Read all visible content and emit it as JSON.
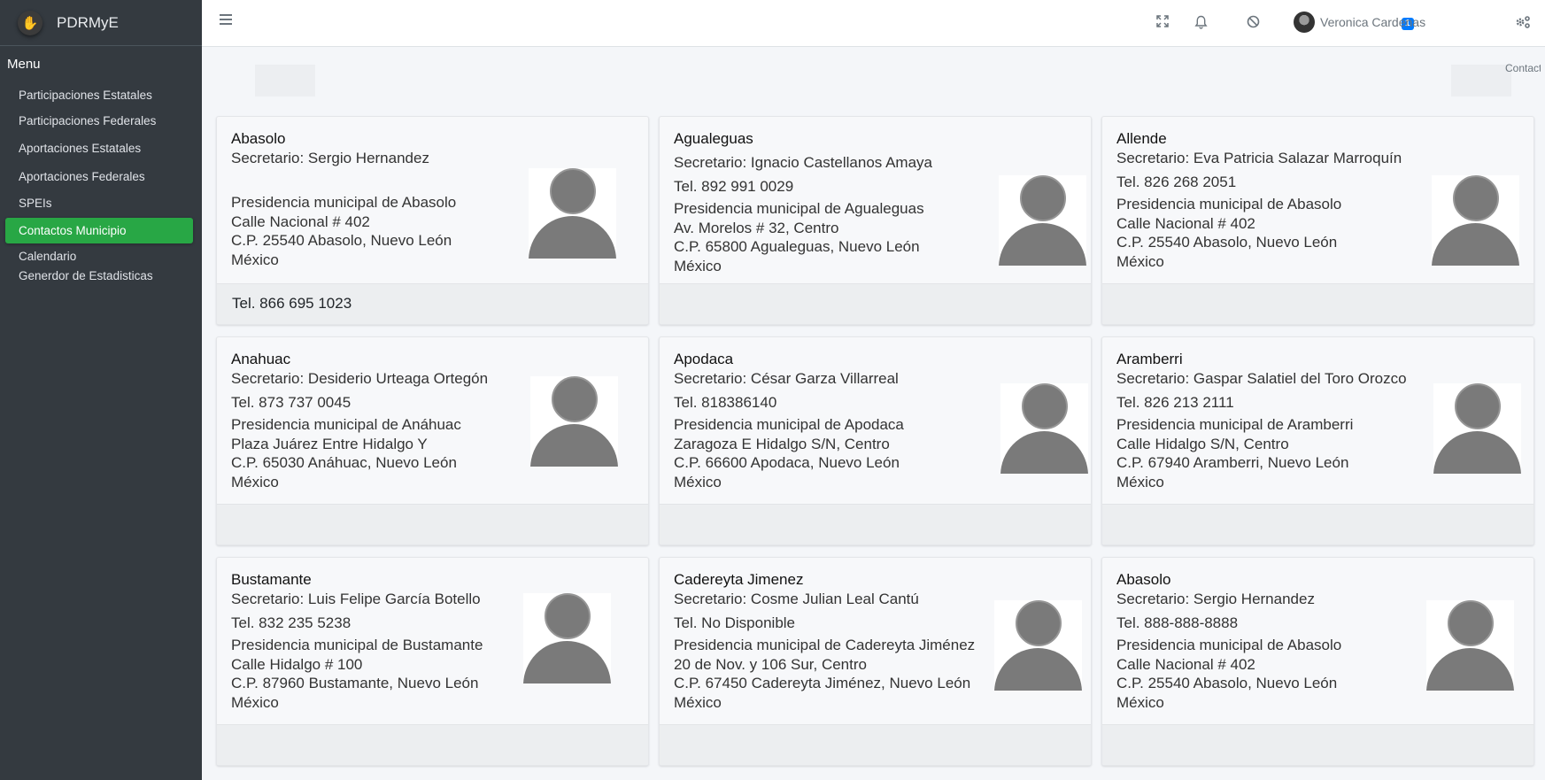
{
  "brand": {
    "name": "PDRMyE"
  },
  "sidebar": {
    "menu_header": "Menu",
    "items": [
      {
        "label": "Participaciones Estatales"
      },
      {
        "label": "Participaciones Federales"
      },
      {
        "label": "Aportaciones Estatales"
      },
      {
        "label": "Aportaciones Federales"
      },
      {
        "label": "SPEIs"
      },
      {
        "label": "Contactos Municipio",
        "active": true
      },
      {
        "label": "Calendario"
      },
      {
        "label": "Generdor de Estadisticas"
      }
    ]
  },
  "topbar": {
    "icons": [
      "menu-icon",
      "fullscreen-icon",
      "bell-icon",
      "ban-icon",
      "gear-icon"
    ],
    "notification_count": "1",
    "user_name": "Veronica Cardenas"
  },
  "breadcrumb": {
    "current": "Contacts"
  },
  "colors": {
    "sidebar": "#343a40",
    "active": "#28a745",
    "badge": "#007bff"
  },
  "cards": [
    {
      "name": "Abasolo",
      "secretary": "Secretario: Sergio Hernandez",
      "tel": "",
      "office": "Presidencia municipal de Abasolo",
      "street": "Calle Nacional # 402",
      "city": "C.P. 25540 Abasolo, Nuevo León",
      "country": "México",
      "footer_tel": "Tel. 866 695 1023"
    },
    {
      "name": "Agualeguas",
      "secretary": "Secretario: Ignacio Castellanos Amaya",
      "tel": "Tel. 892 991 0029",
      "office": "Presidencia municipal de Agualeguas",
      "street": "Av. Morelos # 32, Centro",
      "city": "C.P. 65800 Agualeguas, Nuevo León",
      "country": "México",
      "footer_tel": ""
    },
    {
      "name": "Allende",
      "secretary": "Secretario: Eva Patricia Salazar Marroquín",
      "tel": "Tel. 826 268 2051",
      "office": "Presidencia municipal de Abasolo",
      "street": "Calle Nacional # 402",
      "city": "C.P. 25540 Abasolo, Nuevo León",
      "country": "México",
      "footer_tel": ""
    },
    {
      "name": "Anahuac",
      "secretary": "Secretario: Desiderio Urteaga Ortegón",
      "tel": "Tel. 873 737 0045",
      "office": "Presidencia municipal de Anáhuac",
      "street": "Plaza Juárez Entre Hidalgo Y",
      "city": "C.P. 65030 Anáhuac, Nuevo León",
      "country": "México",
      "footer_tel": ""
    },
    {
      "name": "Apodaca",
      "secretary": "Secretario: César Garza Villarreal",
      "tel": "Tel. 818386140",
      "office": "Presidencia municipal de Apodaca",
      "street": "Zaragoza E Hidalgo S/N, Centro",
      "city": "C.P. 66600 Apodaca, Nuevo León",
      "country": "México",
      "footer_tel": ""
    },
    {
      "name": "Aramberri",
      "secretary": "Secretario: Gaspar Salatiel del Toro Orozco",
      "tel": "Tel. 826 213 2111",
      "office": "Presidencia municipal de Aramberri",
      "street": "Calle Hidalgo S/N, Centro",
      "city": "C.P. 67940 Aramberri, Nuevo León",
      "country": "México",
      "footer_tel": ""
    },
    {
      "name": "Bustamante",
      "secretary": "Secretario: Luis Felipe García Botello",
      "tel": "Tel. 832 235 5238",
      "office": "Presidencia municipal de Bustamante",
      "street": "Calle Hidalgo # 100",
      "city": "C.P. 87960 Bustamante, Nuevo León",
      "country": "México",
      "footer_tel": ""
    },
    {
      "name": "Cadereyta Jimenez",
      "secretary": "Secretario: Cosme Julian Leal Cantú",
      "tel": "Tel. No Disponible",
      "office": "Presidencia municipal de Cadereyta Jiménez",
      "street": "20 de Nov. y 106 Sur, Centro",
      "city": "C.P. 67450 Cadereyta Jiménez, Nuevo León",
      "country": "México",
      "footer_tel": ""
    },
    {
      "name": "Abasolo",
      "secretary": "Secretario: Sergio Hernandez",
      "tel": "Tel. 888-888-8888",
      "office": "Presidencia municipal de Abasolo",
      "street": "Calle Nacional # 402",
      "city": "C.P. 25540 Abasolo, Nuevo León",
      "country": "México",
      "footer_tel": ""
    }
  ]
}
